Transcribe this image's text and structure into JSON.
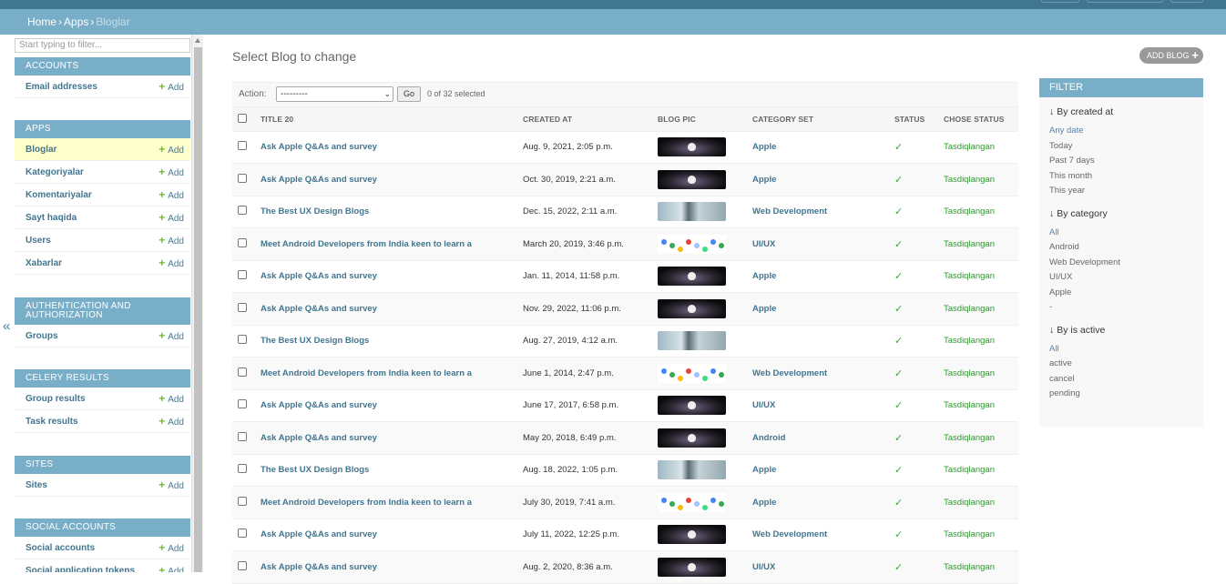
{
  "breadcrumbs": {
    "home": "Home",
    "apps": "Apps",
    "current": "Bloglar",
    "sep": "›"
  },
  "sidebar": {
    "filter_placeholder": "Start typing to filter...",
    "collapse_glyph": "«",
    "add_label": "Add",
    "modules": [
      {
        "caption": "ACCOUNTS",
        "items": [
          {
            "label": "Email addresses"
          }
        ]
      },
      {
        "caption": "APPS",
        "items": [
          {
            "label": "Bloglar",
            "selected": true
          },
          {
            "label": "Kategoriyalar"
          },
          {
            "label": "Komentariyalar"
          },
          {
            "label": "Sayt haqida"
          },
          {
            "label": "Users"
          },
          {
            "label": "Xabarlar"
          }
        ]
      },
      {
        "caption": "AUTHENTICATION AND AUTHORIZATION",
        "items": [
          {
            "label": "Groups"
          }
        ]
      },
      {
        "caption": "CELERY RESULTS",
        "items": [
          {
            "label": "Group results"
          },
          {
            "label": "Task results"
          }
        ]
      },
      {
        "caption": "SITES",
        "items": [
          {
            "label": "Sites"
          }
        ]
      },
      {
        "caption": "SOCIAL ACCOUNTS",
        "items": [
          {
            "label": "Social accounts"
          },
          {
            "label": "Social application tokens"
          }
        ]
      }
    ]
  },
  "main": {
    "title": "Select Blog to change",
    "add_button": "ADD BLOG",
    "actions": {
      "label": "Action:",
      "selected": "---------",
      "go": "Go",
      "count": "0 of 32 selected"
    },
    "columns": [
      "TITLE 20",
      "CREATED AT",
      "BLOG PIC",
      "CATEGORY SET",
      "STATUS",
      "CHOSE STATUS"
    ],
    "rows": [
      {
        "title": "Ask Apple Q&As and survey",
        "created": "Aug. 9, 2021, 2:05 p.m.",
        "pic": "apple",
        "category": "Apple",
        "status": "✓",
        "chose": "Tasdiqlangan"
      },
      {
        "title": "Ask Apple Q&As and survey",
        "created": "Oct. 30, 2019, 2:21 a.m.",
        "pic": "apple",
        "category": "Apple",
        "status": "✓",
        "chose": "Tasdiqlangan"
      },
      {
        "title": "The Best UX Design Blogs",
        "created": "Dec. 15, 2022, 2:11 a.m.",
        "pic": "ux",
        "category": "Web Development",
        "status": "✓",
        "chose": "Tasdiqlangan"
      },
      {
        "title": "Meet Android Developers from India keen to learn a",
        "created": "March 20, 2019, 3:46 p.m.",
        "pic": "droid",
        "category": "UI/UX",
        "status": "✓",
        "chose": "Tasdiqlangan"
      },
      {
        "title": "Ask Apple Q&As and survey",
        "created": "Jan. 11, 2014, 11:58 p.m.",
        "pic": "apple",
        "category": "Apple",
        "status": "✓",
        "chose": "Tasdiqlangan"
      },
      {
        "title": "Ask Apple Q&As and survey",
        "created": "Nov. 29, 2022, 11:06 p.m.",
        "pic": "apple",
        "category": "Apple",
        "status": "✓",
        "chose": "Tasdiqlangan"
      },
      {
        "title": "The Best UX Design Blogs",
        "created": "Aug. 27, 2019, 4:12 a.m.",
        "pic": "ux",
        "category": "",
        "status": "✓",
        "chose": "Tasdiqlangan"
      },
      {
        "title": "Meet Android Developers from India keen to learn a",
        "created": "June 1, 2014, 2:47 p.m.",
        "pic": "droid",
        "category": "Web Development",
        "status": "✓",
        "chose": "Tasdiqlangan"
      },
      {
        "title": "Ask Apple Q&As and survey",
        "created": "June 17, 2017, 6:58 p.m.",
        "pic": "apple",
        "category": "UI/UX",
        "status": "✓",
        "chose": "Tasdiqlangan"
      },
      {
        "title": "Ask Apple Q&As and survey",
        "created": "May 20, 2018, 6:49 p.m.",
        "pic": "apple",
        "category": "Android",
        "status": "✓",
        "chose": "Tasdiqlangan"
      },
      {
        "title": "The Best UX Design Blogs",
        "created": "Aug. 18, 2022, 1:05 p.m.",
        "pic": "ux",
        "category": "Apple",
        "status": "✓",
        "chose": "Tasdiqlangan"
      },
      {
        "title": "Meet Android Developers from India keen to learn a",
        "created": "July 30, 2019, 7:41 a.m.",
        "pic": "droid",
        "category": "Apple",
        "status": "✓",
        "chose": "Tasdiqlangan"
      },
      {
        "title": "Ask Apple Q&As and survey",
        "created": "July 11, 2022, 12:25 p.m.",
        "pic": "apple",
        "category": "Web Development",
        "status": "✓",
        "chose": "Tasdiqlangan"
      },
      {
        "title": "Ask Apple Q&As and survey",
        "created": "Aug. 2, 2020, 8:36 a.m.",
        "pic": "apple",
        "category": "UI/UX",
        "status": "✓",
        "chose": "Tasdiqlangan"
      }
    ]
  },
  "filter": {
    "heading": "FILTER",
    "arrow": "↓",
    "groups": [
      {
        "title": "By created at",
        "items": [
          "Any date",
          "Today",
          "Past 7 days",
          "This month",
          "This year"
        ],
        "active": 0
      },
      {
        "title": "By category",
        "items": [
          "All",
          "Android",
          "Web Development",
          "UI/UX",
          "Apple",
          "-"
        ],
        "active": 0
      },
      {
        "title": "By is active",
        "items": [
          "All",
          "active",
          "cancel",
          "pending"
        ],
        "active": 0
      }
    ]
  },
  "colors": {
    "header": "#417690",
    "breadcrumbs": "#79aec8",
    "link": "#417690",
    "ok": "#40a23b",
    "add_plus": "#70bf2b",
    "selected_row": "#ffffcc"
  }
}
